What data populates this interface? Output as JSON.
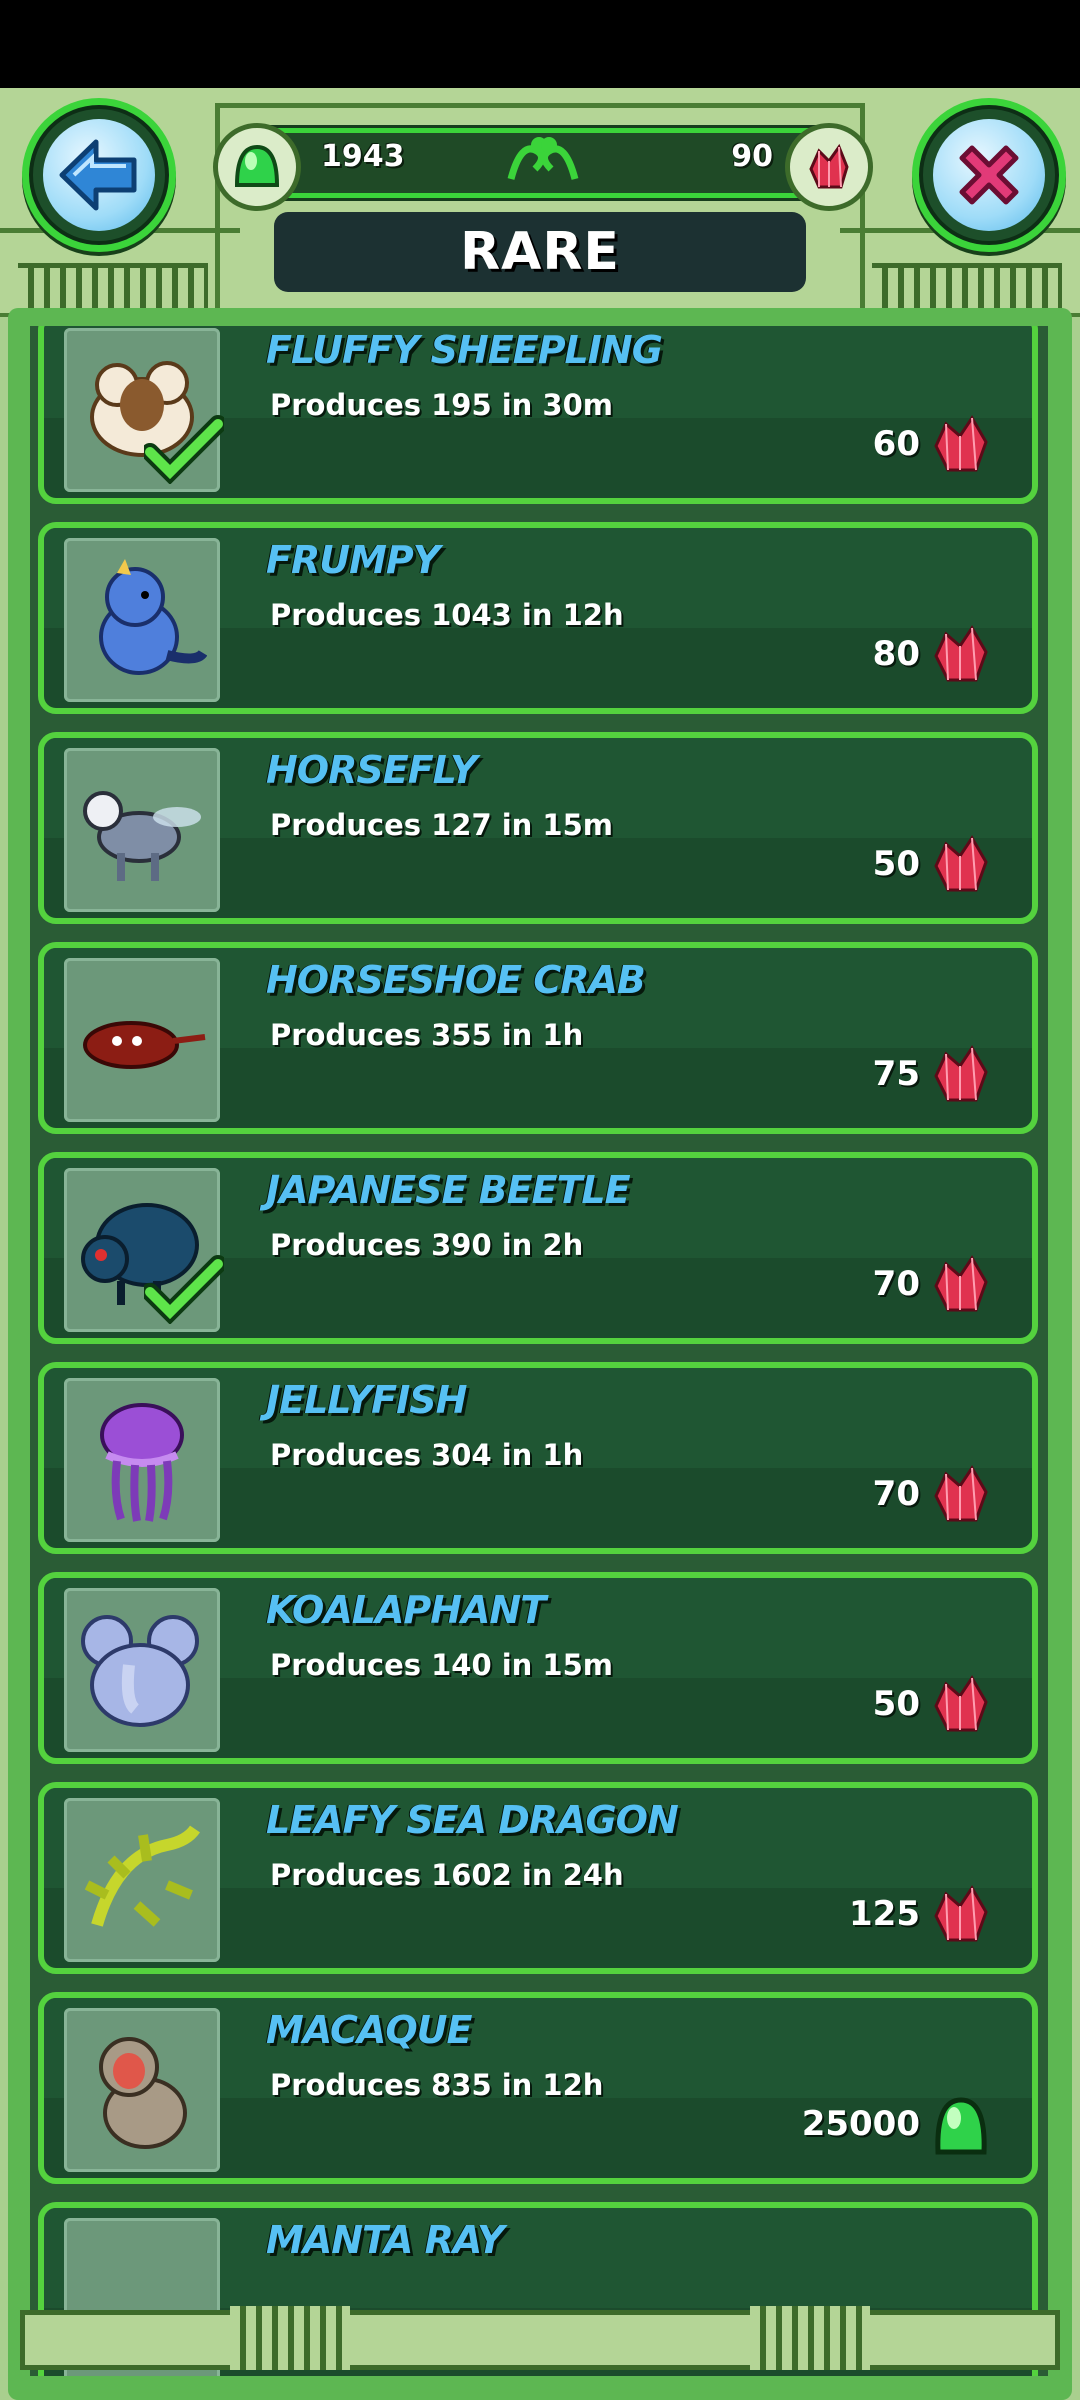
{
  "header": {
    "title": "RARE",
    "food_amount": "1943",
    "gem_amount": "90",
    "back_icon": "back-arrow-icon",
    "close_icon": "close-x-icon"
  },
  "colors": {
    "card_border": "#54d23e",
    "name_text": "#56c0f3",
    "gem": "#e0324f",
    "food": "#2fd24a"
  },
  "items": [
    {
      "name": "FLUFFY SHEEPLING",
      "produces": "Produces 195 in 30m",
      "price": "60",
      "currency": "gem",
      "owned": true
    },
    {
      "name": "FRUMPY",
      "produces": "Produces 1043 in 12h",
      "price": "80",
      "currency": "gem",
      "owned": false
    },
    {
      "name": "HORSEFLY",
      "produces": "Produces 127 in 15m",
      "price": "50",
      "currency": "gem",
      "owned": false
    },
    {
      "name": "HORSESHOE CRAB",
      "produces": "Produces 355 in 1h",
      "price": "75",
      "currency": "gem",
      "owned": false
    },
    {
      "name": "JAPANESE BEETLE",
      "produces": "Produces 390 in 2h",
      "price": "70",
      "currency": "gem",
      "owned": true
    },
    {
      "name": "JELLYFISH",
      "produces": "Produces 304 in 1h",
      "price": "70",
      "currency": "gem",
      "owned": false
    },
    {
      "name": "KOALAPHANT",
      "produces": "Produces 140 in 15m",
      "price": "50",
      "currency": "gem",
      "owned": false
    },
    {
      "name": "LEAFY SEA DRAGON",
      "produces": "Produces 1602 in 24h",
      "price": "125",
      "currency": "gem",
      "owned": false
    },
    {
      "name": "MACAQUE",
      "produces": "Produces 835 in 12h",
      "price": "25000",
      "currency": "food",
      "owned": false
    },
    {
      "name": "MANTA RAY",
      "produces": "",
      "price": "",
      "currency": "gem",
      "owned": false
    }
  ]
}
